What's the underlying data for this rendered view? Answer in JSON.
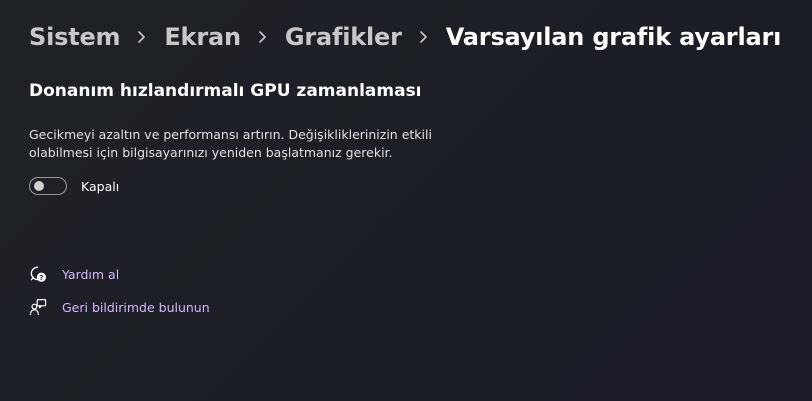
{
  "breadcrumb": {
    "items": [
      {
        "label": "Sistem"
      },
      {
        "label": "Ekran"
      },
      {
        "label": "Grafikler"
      },
      {
        "label": "Varsayılan grafik ayarları"
      }
    ]
  },
  "section": {
    "title": "Donanım hızlandırmalı GPU zamanlaması",
    "description": "Gecikmeyi azaltın ve performansı artırın. Değişikliklerinizin etkili olabilmesi için bilgisayarınızı yeniden başlatmanız gerekir.",
    "toggle": {
      "state": "off",
      "label": "Kapalı"
    }
  },
  "links": {
    "help": {
      "label": "Yardım al",
      "icon": "help-chat-icon"
    },
    "feedback": {
      "label": "Geri bildirimde bulunun",
      "icon": "feedback-icon"
    }
  },
  "colors": {
    "link": "#d7b8ff",
    "background": "#1f2227",
    "text": "#ffffff",
    "breadcrumb_inactive": "#c8c8c8"
  }
}
